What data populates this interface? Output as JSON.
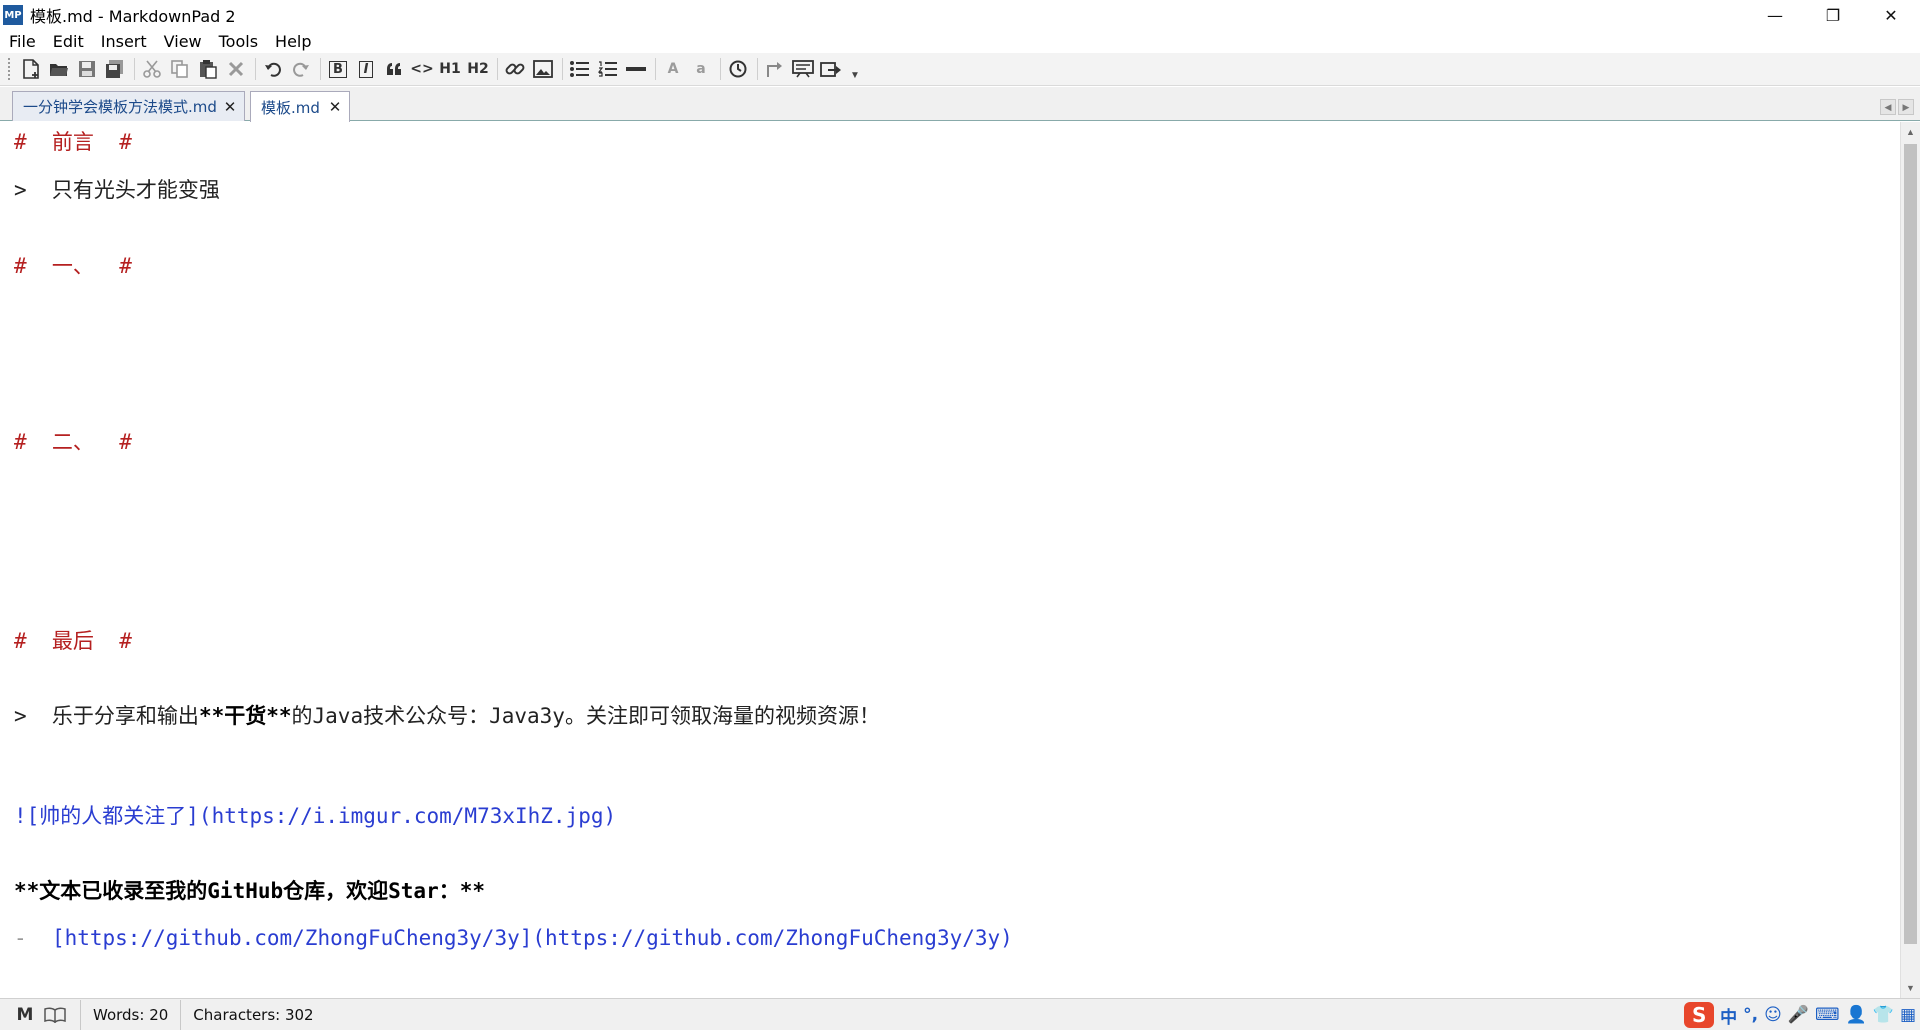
{
  "window": {
    "app_icon_text": "MP",
    "title": "模板.md - MarkdownPad 2",
    "minimize": "—",
    "restore": "❐",
    "close": "✕"
  },
  "menu": {
    "items": [
      "File",
      "Edit",
      "Insert",
      "View",
      "Tools",
      "Help"
    ]
  },
  "toolbar": {
    "h1": "H1",
    "h2": "H2",
    "bold": "B",
    "italic": "I",
    "code": "<>",
    "upper": "A",
    "lower": "a"
  },
  "tabs": [
    {
      "label": "一分钟学会模板方法模式.md",
      "active": false
    },
    {
      "label": "模板.md",
      "active": true
    }
  ],
  "editor": {
    "lines": {
      "l1": "#  前言  #",
      "l2": ">  只有光头才能变强",
      "l3": "#  一、  #",
      "l4": "#  二、  #",
      "l5": "#  最后  #",
      "l6a": ">  乐于分享和输出",
      "l6b": "**干货**",
      "l6c": "的Java技术公众号：Java3y。关注即可领取海量的视频资源！",
      "l7": "![帅的人都关注了](https://i.imgur.com/M73xIhZ.jpg)",
      "l8": "**文本已收录至我的GitHub仓库，欢迎Star：**",
      "l9a": "-  ",
      "l9b": "[https://github.com/ZhongFuCheng3y/3y](https://github.com/ZhongFuCheng3y/3y)"
    }
  },
  "status": {
    "words": "Words: 20",
    "characters": "Characters: 302",
    "ime": {
      "logo": "S",
      "lang": "中",
      "punct": "°,",
      "emoji": "☺",
      "mic": "🎤",
      "keyboard": "⌨",
      "user": "👤",
      "shirt": "👕",
      "grid": "▦"
    }
  },
  "colors": {
    "heading": "#b52020",
    "link": "#2a3dd1",
    "tab_text": "#1c4a8a"
  }
}
